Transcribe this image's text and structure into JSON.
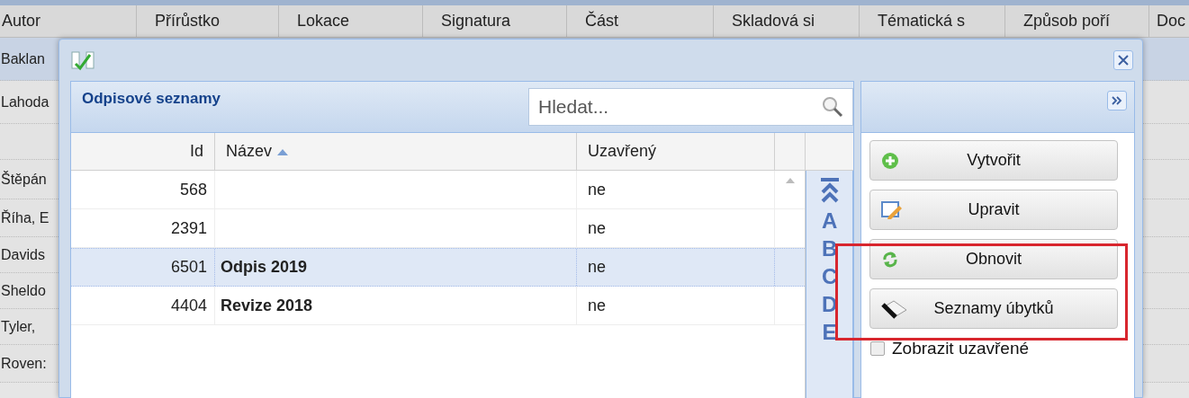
{
  "background_table": {
    "columns": [
      "Autor",
      "Přírůstko",
      "Lokace",
      "Signatura",
      "Část",
      "Skladová si",
      "Tématická s",
      "Způsob poří",
      "Doc"
    ],
    "rows": [
      {
        "author": "Baklan",
        "selected": true
      },
      {
        "author": "Lahoda",
        "selected": false
      },
      {
        "selected": false
      },
      {
        "author": "Štěpán",
        "selected": false
      },
      {
        "author": "Říha, E",
        "selected": false
      },
      {
        "author": "Davids",
        "selected": false
      },
      {
        "author": "Sheldo",
        "selected": false
      },
      {
        "author": "Tyler,",
        "selected": false
      },
      {
        "author": "Roven:",
        "selected": false
      }
    ]
  },
  "dialog": {
    "panel_title": "Odpisové seznamy",
    "search": {
      "placeholder": "Hledat..."
    },
    "columns": [
      "Id",
      "Název",
      "Uzavřený"
    ],
    "rows": [
      {
        "id": "568",
        "closed": "ne",
        "selected": false
      },
      {
        "id": "2391",
        "closed": "ne",
        "selected": false
      },
      {
        "id": "6501",
        "name": "Odpis 2019",
        "closed": "ne",
        "selected": true
      },
      {
        "id": "4404",
        "name": "Revize 2018",
        "closed": "ne",
        "selected": false
      }
    ],
    "alphabet": [
      "A",
      "B",
      "C",
      "D",
      "E"
    ],
    "actions": [
      {
        "kind": "create",
        "label": "Vytvořit"
      },
      {
        "kind": "edit",
        "label": "Upravit"
      },
      {
        "kind": "refresh",
        "label": "Obnovit"
      },
      {
        "kind": "book",
        "label": "Seznamy úbytků"
      }
    ],
    "show_closed": {
      "label": "Zobrazit uzavřené",
      "checked": false
    }
  }
}
